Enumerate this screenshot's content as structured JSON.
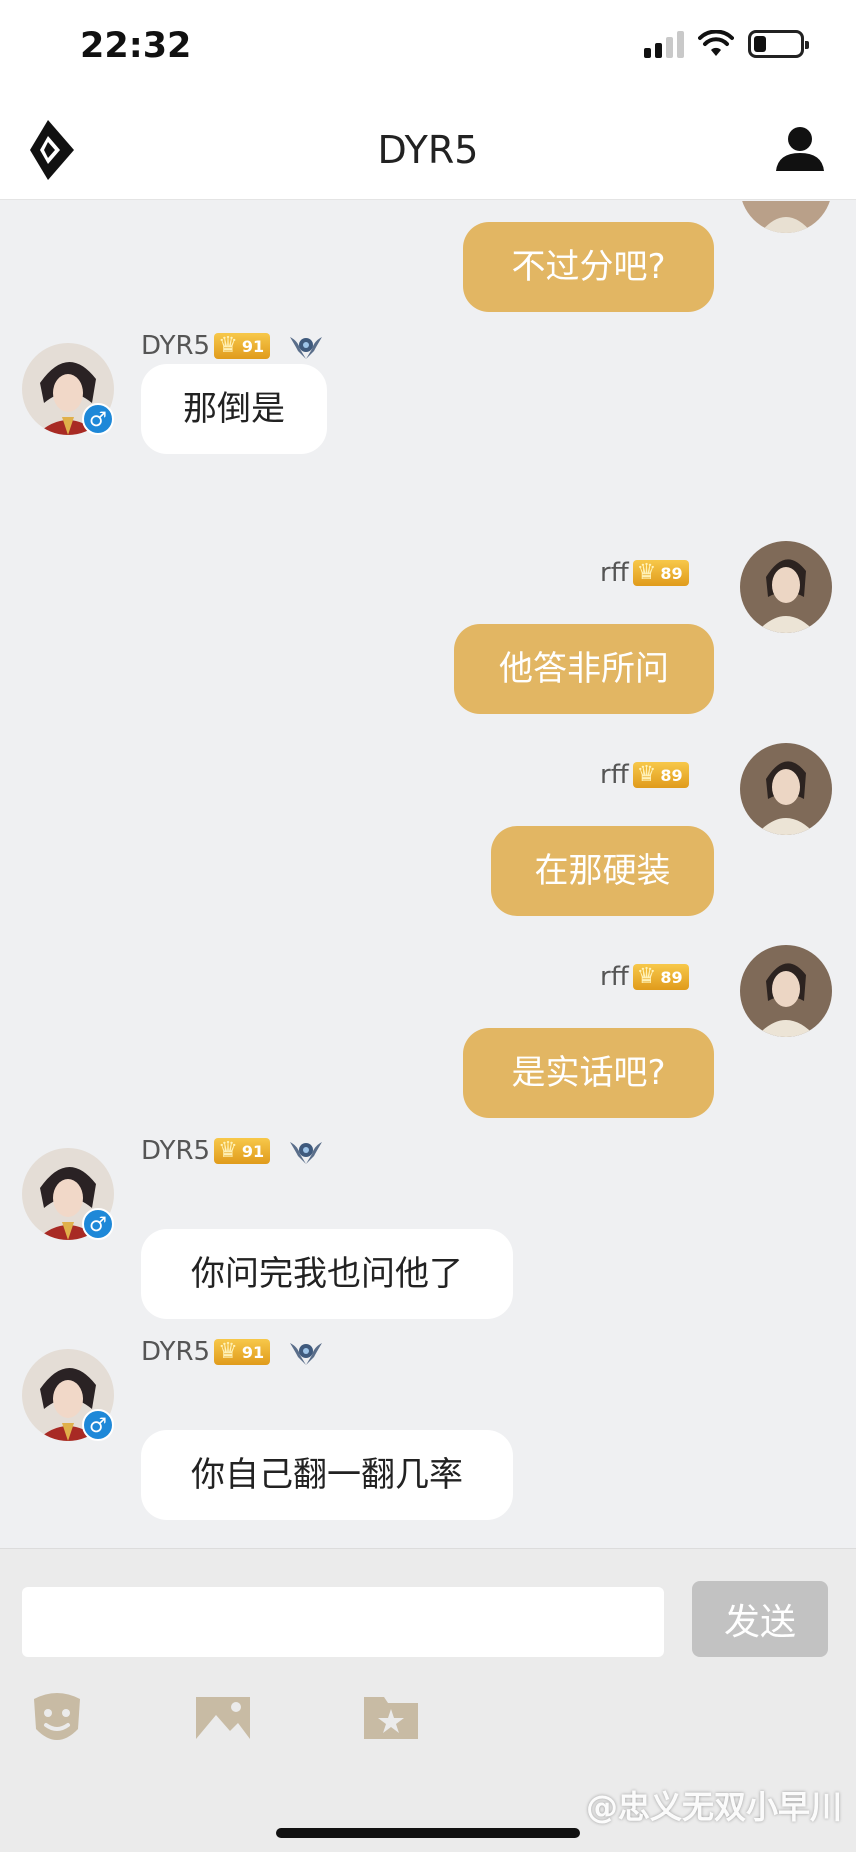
{
  "status_bar": {
    "time": "22:32"
  },
  "header": {
    "title": "DYR5"
  },
  "messages": [
    {
      "sender": "",
      "text": "不过分吧?"
    },
    {
      "sender": "DYR5",
      "level": "91",
      "text": "那倒是"
    },
    {
      "sender": "rff",
      "level": "89",
      "text": "他答非所问"
    },
    {
      "sender": "rff",
      "level": "89",
      "text": "在那硬装"
    },
    {
      "sender": "rff",
      "level": "89",
      "text": "是实话吧?"
    },
    {
      "sender": "DYR5",
      "level": "91",
      "text": "你问完我也问他了"
    },
    {
      "sender": "DYR5",
      "level": "91",
      "text": "你自己翻一翻几率"
    }
  ],
  "gender_symbol": "♂",
  "composer": {
    "input_value": "",
    "send_label": "发送"
  },
  "watermark": "@忠义无双小早川",
  "icons": [
    "logo-icon",
    "user-icon",
    "emoji-icon",
    "image-icon",
    "game-icon"
  ],
  "colors": {
    "outgoing_bubble": "#e2b663",
    "incoming_bubble": "#ffffff",
    "send_button": "#c2c2c2",
    "level_badge": "#f0b232"
  }
}
